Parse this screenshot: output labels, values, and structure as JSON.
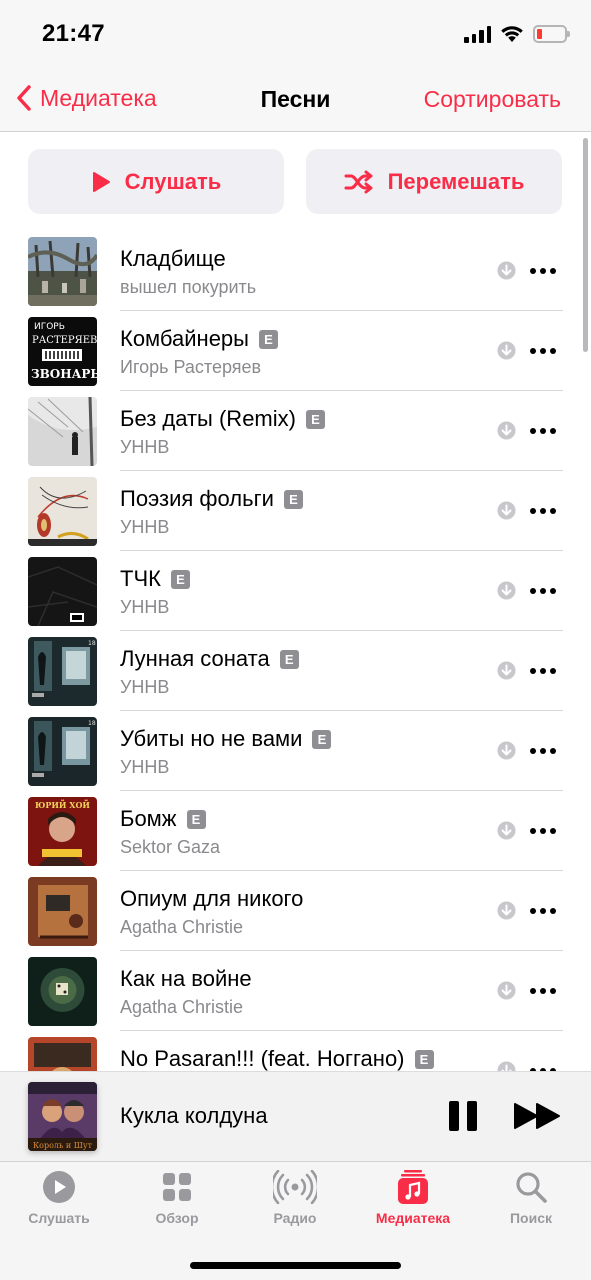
{
  "status_bar": {
    "time": "21:47",
    "icons": [
      "cellular-signal-icon",
      "wifi-icon",
      "battery-low-icon"
    ],
    "battery_color": "#ff3b30"
  },
  "nav": {
    "back_label": "Медиатека",
    "title": "Песни",
    "sort_label": "Сортировать",
    "accent_color": "#fa2d48"
  },
  "actions": {
    "play_label": "Слушать",
    "shuffle_label": "Перемешать"
  },
  "songs": [
    {
      "title": "Кладбище",
      "artist": "вышел покурить",
      "explicit": false
    },
    {
      "title": "Комбайнеры",
      "artist": "Игорь Растеряев",
      "explicit": true
    },
    {
      "title": "Без даты (Remix)",
      "artist": "УННВ",
      "explicit": true
    },
    {
      "title": "Поэзия фольги",
      "artist": "УННВ",
      "explicit": true
    },
    {
      "title": "ТЧК",
      "artist": "УННВ",
      "explicit": true
    },
    {
      "title": "Лунная соната",
      "artist": "УННВ",
      "explicit": true
    },
    {
      "title": "Убиты но не вами",
      "artist": "УННВ",
      "explicit": true
    },
    {
      "title": "Бомж",
      "artist": "Sektor Gaza",
      "explicit": true
    },
    {
      "title": "Опиум для никого",
      "artist": "Agatha Christie",
      "explicit": false
    },
    {
      "title": "Как на войне",
      "artist": "Agatha Christie",
      "explicit": false
    },
    {
      "title": "No Pasaran!!! (feat. Ноггано)",
      "artist": "",
      "explicit": true
    }
  ],
  "explicit_badge": "E",
  "album_art_texts": {
    "kombainery_line1": "ИГОРЬ",
    "kombainery_line2": "РАСТЕРЯЕВ",
    "kombainery_line3": "ЗВОНАРЬ",
    "bomzh_top": "ЮРИЙ ХОЙ",
    "mini_bottom": "Король и Шут"
  },
  "now_playing": {
    "title": "Кукла колдуна",
    "controls": [
      "pause-icon",
      "next-track-icon"
    ]
  },
  "tabs": [
    {
      "label": "Слушать",
      "icon": "play-circle-icon",
      "active": false
    },
    {
      "label": "Обзор",
      "icon": "grid-icon",
      "active": false
    },
    {
      "label": "Радио",
      "icon": "radio-waves-icon",
      "active": false
    },
    {
      "label": "Медиатека",
      "icon": "library-music-icon",
      "active": true
    },
    {
      "label": "Поиск",
      "icon": "search-icon",
      "active": false
    }
  ]
}
